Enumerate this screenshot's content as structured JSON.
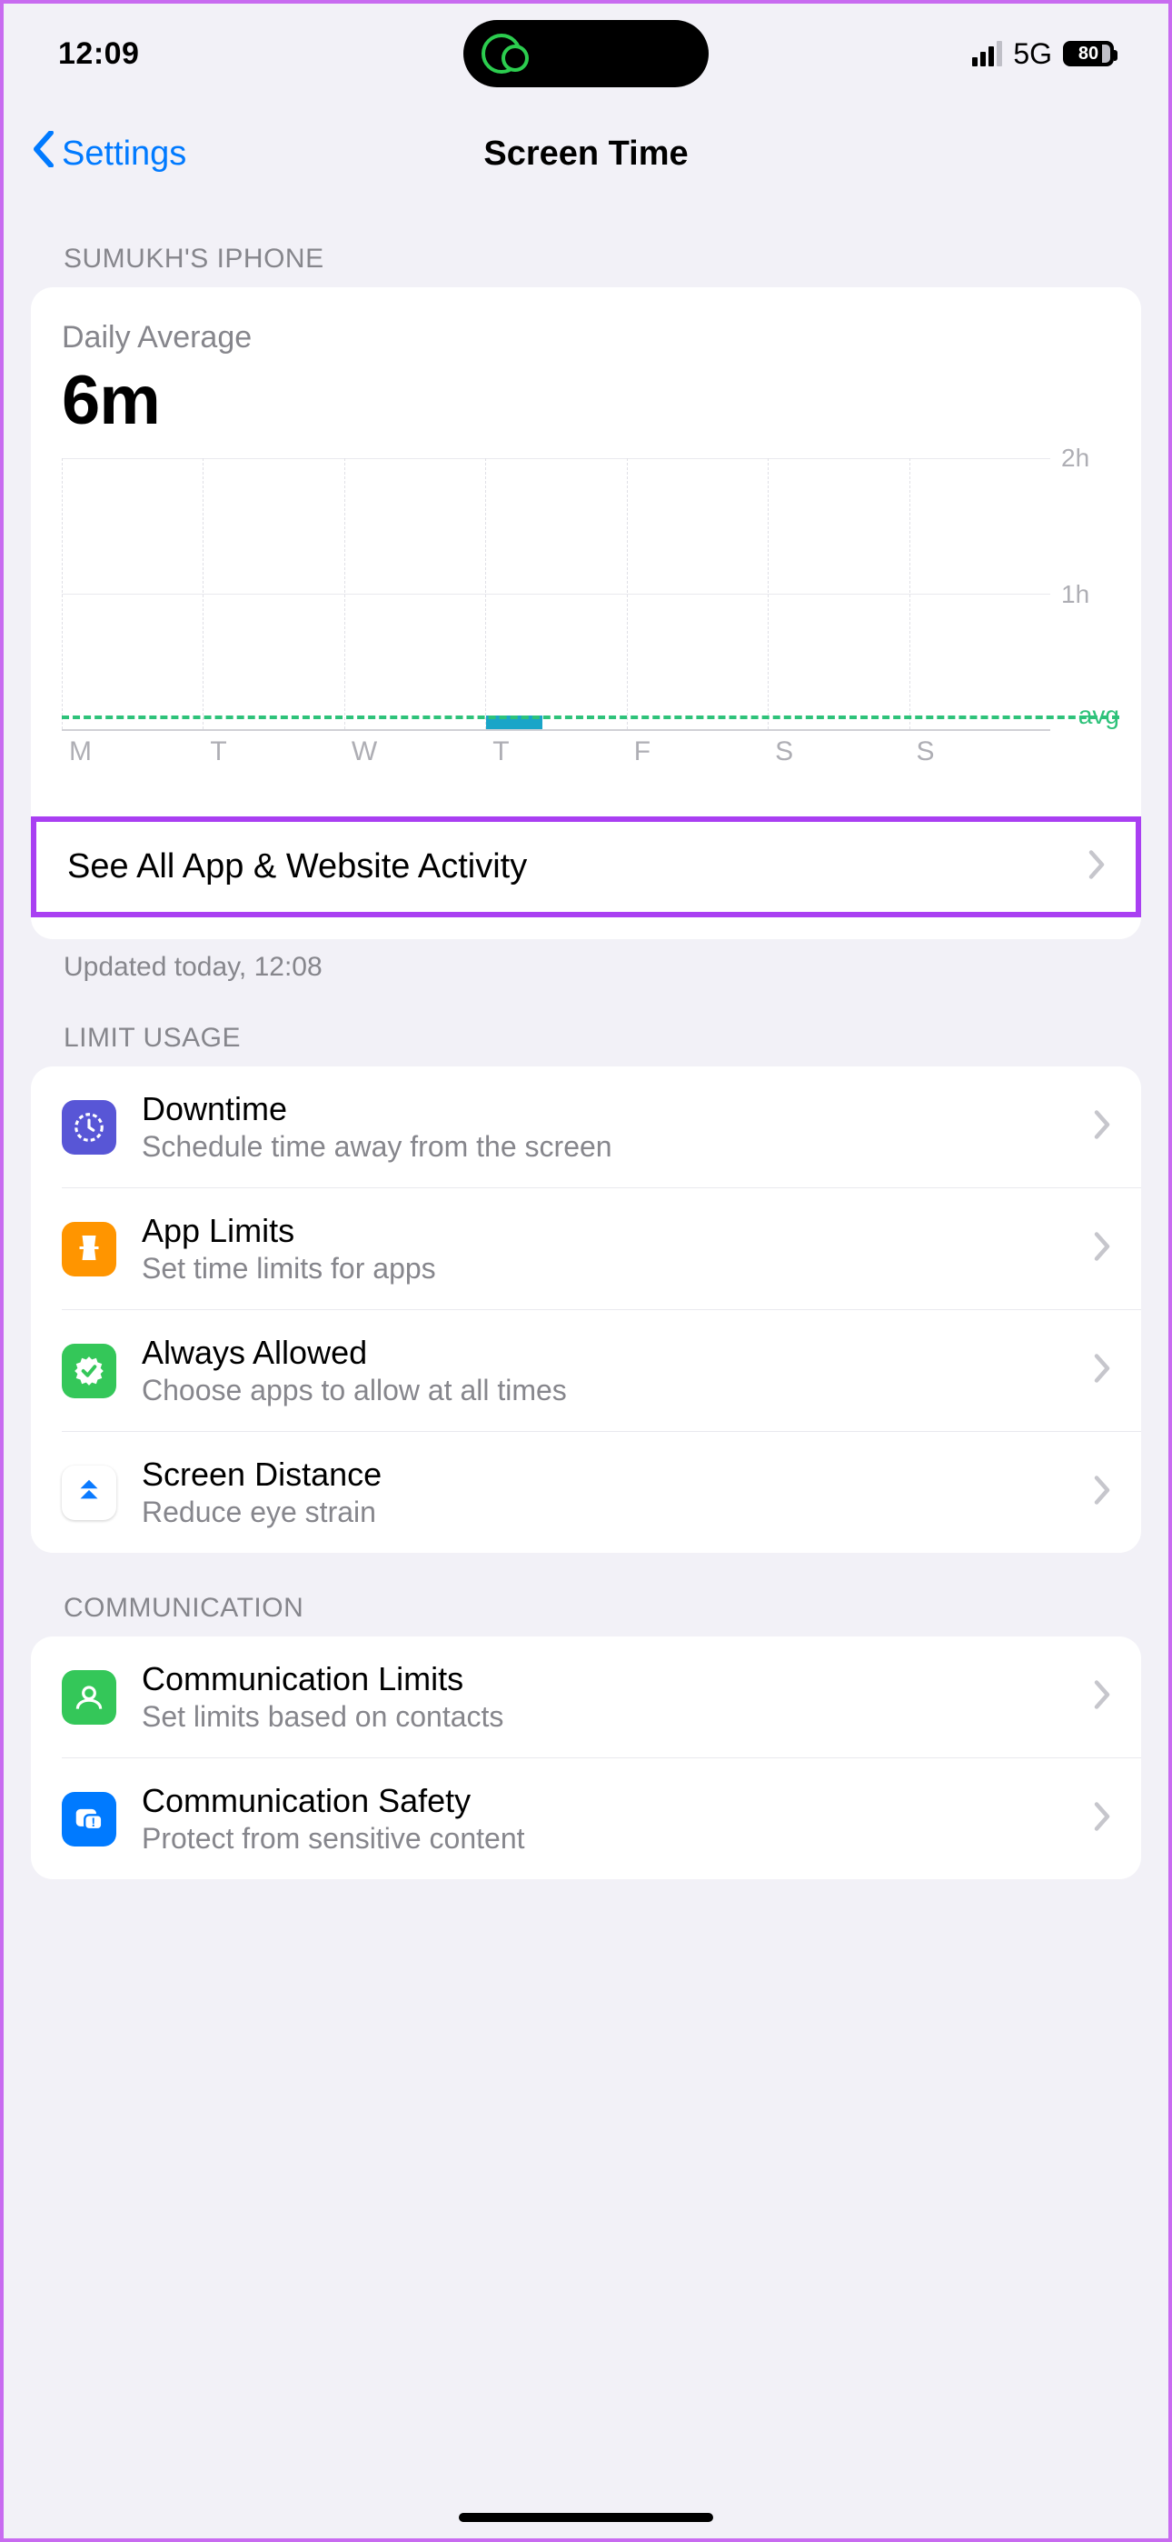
{
  "status_bar": {
    "time": "12:09",
    "network": "5G",
    "battery": "80"
  },
  "nav": {
    "back": "Settings",
    "title": "Screen Time"
  },
  "device_header": "SUMUKH'S IPHONE",
  "summary": {
    "label": "Daily Average",
    "value": "6m",
    "updated": "Updated today, 12:08",
    "see_all": "See All App & Website Activity"
  },
  "chart_data": {
    "type": "bar",
    "categories": [
      "M",
      "T",
      "W",
      "T",
      "F",
      "S",
      "S"
    ],
    "values": [
      0,
      0,
      0,
      6,
      0,
      0,
      0
    ],
    "y_ticks": [
      "2h",
      "1h"
    ],
    "y_tick_values": [
      120,
      60
    ],
    "avg_label": "avg",
    "avg_value": 6,
    "ylim": [
      0,
      120
    ],
    "xlabel": "",
    "ylabel": "",
    "title": ""
  },
  "limit_header": "LIMIT USAGE",
  "limit_items": [
    {
      "title": "Downtime",
      "sub": "Schedule time away from the screen",
      "icon": "downtime-icon"
    },
    {
      "title": "App Limits",
      "sub": "Set time limits for apps",
      "icon": "app-limits-icon"
    },
    {
      "title": "Always Allowed",
      "sub": "Choose apps to allow at all times",
      "icon": "always-allowed-icon"
    },
    {
      "title": "Screen Distance",
      "sub": "Reduce eye strain",
      "icon": "screen-distance-icon"
    }
  ],
  "comm_header": "COMMUNICATION",
  "comm_items": [
    {
      "title": "Communication Limits",
      "sub": "Set limits based on contacts",
      "icon": "comm-limits-icon"
    },
    {
      "title": "Communication Safety",
      "sub": "Protect from sensitive content",
      "icon": "comm-safety-icon"
    }
  ]
}
